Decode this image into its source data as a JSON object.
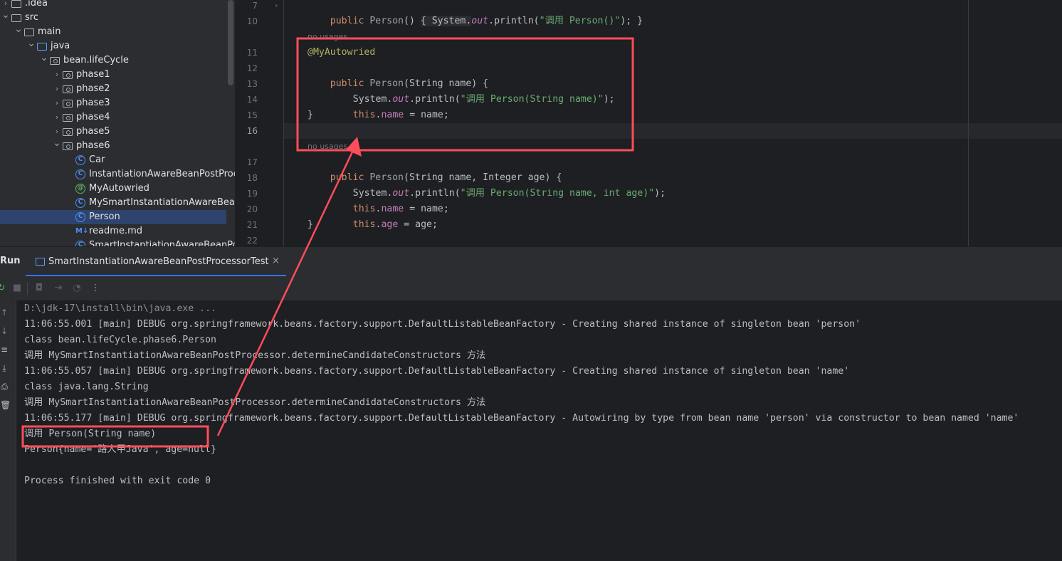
{
  "project_tree": [
    {
      "label": ".idea",
      "type": "folder",
      "level": 1,
      "arrow": "right"
    },
    {
      "label": "src",
      "type": "folder",
      "level": 1,
      "arrow": "down"
    },
    {
      "label": "main",
      "type": "folder",
      "level": 2,
      "arrow": "down"
    },
    {
      "label": "java",
      "type": "source-folder",
      "level": 3,
      "arrow": "down"
    },
    {
      "label": "bean.lifeCycle",
      "type": "package",
      "level": 4,
      "arrow": "down"
    },
    {
      "label": "phase1",
      "type": "package",
      "level": 5,
      "arrow": "right"
    },
    {
      "label": "phase2",
      "type": "package",
      "level": 5,
      "arrow": "right"
    },
    {
      "label": "phase3",
      "type": "package",
      "level": 5,
      "arrow": "right"
    },
    {
      "label": "phase4",
      "type": "package",
      "level": 5,
      "arrow": "right"
    },
    {
      "label": "phase5",
      "type": "package",
      "level": 5,
      "arrow": "right"
    },
    {
      "label": "phase6",
      "type": "package",
      "level": 5,
      "arrow": "down"
    },
    {
      "label": "Car",
      "type": "class",
      "level": 6
    },
    {
      "label": "InstantiationAwareBeanPostProcessor",
      "type": "class",
      "level": 6
    },
    {
      "label": "MyAutowried",
      "type": "annotation",
      "level": 6
    },
    {
      "label": "MySmartInstantiationAwareBeanPostProcessor",
      "type": "class",
      "level": 6
    },
    {
      "label": "Person",
      "type": "class",
      "level": 6,
      "selected": true
    },
    {
      "label": "readme.md",
      "type": "markdown",
      "level": 6
    },
    {
      "label": "SmartInstantiationAwareBeanPostProcessorTest",
      "type": "class",
      "level": 6
    }
  ],
  "editor": {
    "line_numbers": [
      "7",
      "10",
      "11",
      "12",
      "13",
      "14",
      "15",
      "16",
      "17",
      "18",
      "19",
      "20",
      "21",
      "22"
    ],
    "usage_hints": [
      "no usages",
      "no usages"
    ],
    "code": {
      "l7": [
        "public",
        " ",
        "Person",
        "() ",
        "{ System.",
        "out",
        ".println(",
        "\"调用 Person()\"",
        "); }"
      ],
      "l11": "@MyAutowried",
      "l12": [
        "public",
        " ",
        "Person",
        "(String name) {"
      ],
      "l13": [
        "System.",
        "out",
        ".println(",
        "\"调用 Person(String name)\"",
        ");"
      ],
      "l14": [
        "this",
        ".",
        "name",
        " = name;"
      ],
      "l15": "}",
      "l17": [
        "public",
        " ",
        "Person",
        "(String name, Integer age) {"
      ],
      "l18": [
        "System.",
        "out",
        ".println(",
        "\"调用 Person(String name, int age)\"",
        ");"
      ],
      "l19": [
        "this",
        ".",
        "name",
        " = name;"
      ],
      "l20": [
        "this",
        ".",
        "age",
        " = age;"
      ],
      "l21": "}"
    }
  },
  "run_panel": {
    "title": "Run",
    "tab_label": "SmartInstantiationAwareBeanPostProcessorTest",
    "tab_close": "×",
    "console_lines": [
      "D:\\jdk-17\\install\\bin\\java.exe ...",
      "11:06:55.001 [main] DEBUG org.springframework.beans.factory.support.DefaultListableBeanFactory - Creating shared instance of singleton bean 'person'",
      "class bean.lifeCycle.phase6.Person",
      "调用 MySmartInstantiationAwareBeanPostProcessor.determineCandidateConstructors 方法",
      "11:06:55.057 [main] DEBUG org.springframework.beans.factory.support.DefaultListableBeanFactory - Creating shared instance of singleton bean 'name'",
      "class java.lang.String",
      "调用 MySmartInstantiationAwareBeanPostProcessor.determineCandidateConstructors 方法",
      "11:06:55.177 [main] DEBUG org.springframework.beans.factory.support.DefaultListableBeanFactory - Autowiring by type from bean name 'person' via constructor to bean named 'name'",
      "调用 Person(String name)",
      "Person{name='路人甲Java', age=null}",
      "",
      "Process finished with exit code 0"
    ]
  },
  "colors": {
    "annotation_box": "#ff4d5a",
    "keyword": "#cf8e6d",
    "string": "#6aab73",
    "field": "#c77dbb",
    "annotation": "#b3ae60",
    "accent": "#3574f0"
  }
}
